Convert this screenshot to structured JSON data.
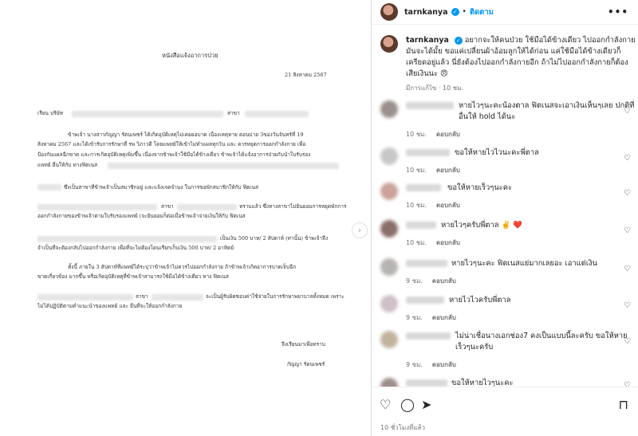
{
  "document": {
    "title": "หนังสือแจ้งอาการป่วย",
    "date": "21 สิงหาคม 2567",
    "salutation": "เรียน บริษัท",
    "branch_label": "สาขา",
    "p1_l1": "ข้าพเจ้า นางสาวกัญญา รัตนเพชร์ ได้เกิดอุบัติเหตุไม่เคยยอบาด เนื่องเหตุหาย ตอนบ่าย 3ของวันจันทร์ที่ 19",
    "p1_l2": "สิงหาคม 2567 และได้เข้ารับการรักษาที่ รพ วิภาวดี โดยแพทย์ให้เข้าไม่ทำแผลทุกวัน และ ควรหยุดการออกกำลังกาย เพื่อ",
    "p1_l3": "ป้องกันแผลฉีกขาด และการเกิดอุบัติเหตุเพิ่มขึ้น เนื่องจากข้าพเจ้าใช้มือได้ข้างเดียว ข้าพเจ้าได้แจ้งอาการป่วยกับนำใบรับรอง",
    "p1_l4": "แพทย์ ยื่นให้กับ ทางฟิตเนส",
    "p1_l5": "ซึ่งเป็นสาขาที่ข้าพเจ้าเป็นสมาชิกอยู่ และแจ้งเจตจำนง ในการขอพักสมาชิกให้กับ ฟิตเนส",
    "p1_l6": "สาขา",
    "p1_l6b": "ทราบแล้ว ซึ่งทางสาขาไม่ยินยอมการหยุดพักการ",
    "p1_l7": "ออกกำลังกายของข้าพเจ้าตามใบรับรองแพทย์ (จะยินยอมก็ต่อเมื่อข้าพเจ้าจ่ายเงินให้กับ ฟิตเนส",
    "p1_l8": "เป็นเงิน 500 บาท/ 2 สัปดาห์ (ท่านั้น) ข้าพเจ้าจึง",
    "p1_l9": "จำเป็นที่จะต้องกลับไปออกกำลังกาย เพื่อที่จะไม่ต้องโดนเรียกเก็บเงิน 500 บาท/ 2 อาทิตย์",
    "p2_l1": "ทั้งนี้ ภายใน 3 สัปดาห์ที่แพทย์ได้ระบุว่าข้าพเจ้าไม่ควรไปออกกำลังกาย ถ้าข้าพเจ้าเกิดอาการบาดเจ็บฉีก",
    "p2_l2": "ขาดเกี่ยวข้อง มากขึ้น หรือเกิดอุบัติเหตุที่ข้าพเจ้าสามารถใช้มือได้ข้างเดียว ทาง ฟิตเนส",
    "p2_l3": "สาขา",
    "p2_l3b": "จะเป็นผู้รับผิดชอบค่าใช้จ่ายในการรักษาพยาบาลทั้งหมด เพราะ",
    "p2_l4": "ไม่ได้ปฏิบัติตามคำแนะนำของแพทย์ และ ยืนที่จะให้ออกกำลังกาย",
    "closing": "จึงเรียนมาเพื่อทราบ",
    "signature": "กัญญา รัตนเพชร์"
  },
  "header": {
    "username": "tarnkanya",
    "dot": "•",
    "follow": "ติดตาม",
    "more": "•••"
  },
  "caption": {
    "username": "tarnkanya",
    "text": "อยากจะให้คนป่วย ใช้มือได้ข้างเดียว ไปออกกำลังกาย มันจะได้มั้ย ขอแค่เปลี่ยนผ้าอ้อมลูกให้ได้ก่อน แค่ใช้มือได้ข้างเดียวก็เครียดอยู่แล้ว นี่ยังต้องไปออกกำลังกายอีก ถ้าไม่ไปออกกำลังกายก็ต้องเสียเงินนะ",
    "emoji": "😠",
    "edited": "มีการแก้ไข",
    "time": "10 ชม."
  },
  "comments": [
    {
      "text": "หายไวๆนะคะน้องตาล ฟิตเนสจะเอาเงินเห็นๆเลย ปกติที่อื่นให้ hold ได้นะ",
      "time": "10 ชม.",
      "reply": "ตอบกลับ"
    },
    {
      "text": "ขอให้หายไวไวนะคะพี่ตาล",
      "time": "10 ชม.",
      "reply": "ตอบกลับ"
    },
    {
      "text": "ขอให้หายเร็วๆนะคะ",
      "time": "10 ชม.",
      "reply": "ตอบกลับ"
    },
    {
      "text": "หายไวๆครับพี่ตาล",
      "emoji": "✌️ ❤️",
      "time": "10 ชม.",
      "reply": "ตอบกลับ"
    },
    {
      "text": "หายไวๆนะคะ ฟิตเนสแย่มากเลยอะ เอาแต่เงิน",
      "time": "9 ชม.",
      "reply": "ตอบกลับ"
    },
    {
      "text": "หายไวไวครับพี่ตาล",
      "time": "9 ชม.",
      "reply": "ตอบกลับ"
    },
    {
      "text": "ไม่น่าเชื่อนางเอกช่อง7 คงเป็นแบบนี้ละครับ ขอให้หายเร็วๆนะครับ",
      "time": "9 ชม.",
      "reply": "ตอบกลับ"
    },
    {
      "text": "ขอให้หายไวๆนะคะ"
    }
  ],
  "footer": {
    "time": "10 ชั่วโมงที่แล้ว"
  },
  "icons": [
    "heart-icon",
    "comment-icon",
    "share-icon",
    "bookmark-icon",
    "chevron-right-icon",
    "verified-icon"
  ]
}
